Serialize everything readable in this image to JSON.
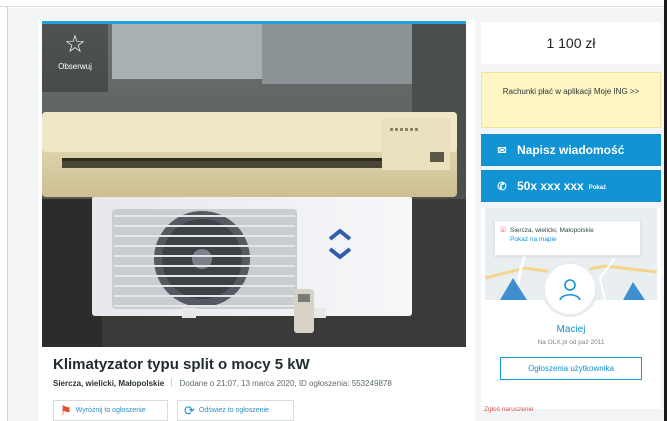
{
  "ad": {
    "observe_label": "Obserwuj",
    "title": "Klimatyzator typu split o mocy 5 kW",
    "location": "Siercza, wielicki, Małopolskie",
    "added": "Dodane o 21:07, 13 marca 2020, ID ogłoszenia: 553249878",
    "promote_label": "Wyróżnij to ogłoszenie",
    "refresh_label": "Odśwież to ogłoszenie"
  },
  "sidebar": {
    "price": "1 100 zł",
    "ing_banner": "Rachunki płać w aplikacji Moje ING >>",
    "message_button": "Napisz wiadomość",
    "phone_number": "50x xxx xxx",
    "phone_show": "Pokaż",
    "map_location": "Siercza, wielicki, Małopolskie",
    "map_link": "Pokaż na mapie",
    "user_name": "Maciej",
    "user_since": "Na OLX.pl od paź 2011",
    "user_ads_button": "Ogłoszenia użytkownika",
    "report_link": "Zgłoś naruszenie"
  },
  "colors": {
    "accent": "#1293d3",
    "ing_background": "#fff6c4",
    "report": "#e0504d"
  },
  "icons": {
    "observe": "star-icon",
    "message": "envelope-icon",
    "phone": "phone-icon",
    "map_pin": "map-pin-icon",
    "avatar": "user-icon",
    "promote": "flag-icon",
    "refresh": "refresh-icon"
  }
}
